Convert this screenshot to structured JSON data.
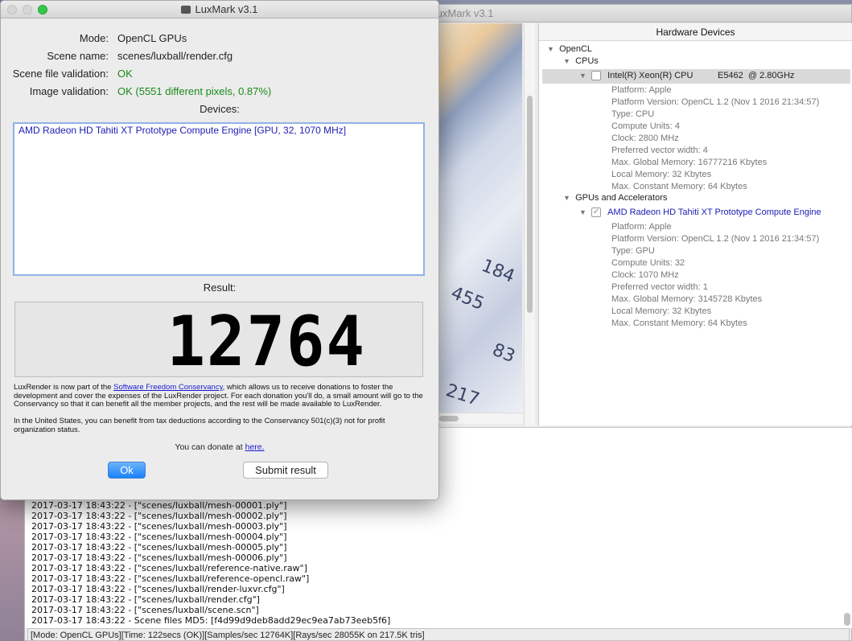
{
  "main_window": {
    "title": "LuxMark v3.1",
    "scene_numbers": [
      "184",
      "455",
      "83",
      "217"
    ]
  },
  "hardware": {
    "header": "Hardware Devices",
    "root": "OpenCL",
    "cpus_label": "CPUs",
    "cpu_device": {
      "name": "Intel(R) Xeon(R) CPU          E5462  @ 2.80GHz",
      "props": [
        "Platform: Apple",
        "Platform Version: OpenCL 1.2 (Nov  1 2016 21:34:57)",
        "Type: CPU",
        "Compute Units: 4",
        "Clock: 2800 MHz",
        "Preferred vector width: 4",
        "Max. Global Memory: 16777216 Kbytes",
        "Local Memory: 32 Kbytes",
        "Max. Constant Memory: 64 Kbytes"
      ]
    },
    "gpus_label": "GPUs and Accelerators",
    "gpu_device": {
      "name": "AMD Radeon HD Tahiti XT Prototype Compute Engine",
      "props": [
        "Platform: Apple",
        "Platform Version: OpenCL 1.2 (Nov  1 2016 21:34:57)",
        "Type: GPU",
        "Compute Units: 32",
        "Clock: 1070 MHz",
        "Preferred vector width: 1",
        "Max. Global Memory: 3145728 Kbytes",
        "Local Memory: 32 Kbytes",
        "Max. Constant Memory: 64 Kbytes"
      ]
    }
  },
  "log": [
    "2017-03-17 18:43:22 -   [\"scenes/luxball/mesh-00001.ply\"]",
    "2017-03-17 18:43:22 -   [\"scenes/luxball/mesh-00002.ply\"]",
    "2017-03-17 18:43:22 -   [\"scenes/luxball/mesh-00003.ply\"]",
    "2017-03-17 18:43:22 -   [\"scenes/luxball/mesh-00004.ply\"]",
    "2017-03-17 18:43:22 -   [\"scenes/luxball/mesh-00005.ply\"]",
    "2017-03-17 18:43:22 -   [\"scenes/luxball/mesh-00006.ply\"]",
    "2017-03-17 18:43:22 -   [\"scenes/luxball/reference-native.raw\"]",
    "2017-03-17 18:43:22 -   [\"scenes/luxball/reference-opencl.raw\"]",
    "2017-03-17 18:43:22 -   [\"scenes/luxball/render-luxvr.cfg\"]",
    "2017-03-17 18:43:22 -   [\"scenes/luxball/render.cfg\"]",
    "2017-03-17 18:43:22 -   [\"scenes/luxball/scene.scn\"]",
    "2017-03-17 18:43:22 - Scene files MD5: [f4d99d9deb8add29ec9ea7ab73eeb5f6]"
  ],
  "status_bar": "[Mode: OpenCL GPUs][Time: 122secs (OK)][Samples/sec  12764K][Rays/sec  28055K on 217.5K tris]",
  "dialog": {
    "title": "LuxMark v3.1",
    "mode_label": "Mode:",
    "mode_value": "OpenCL GPUs",
    "scene_label": "Scene name:",
    "scene_value": "scenes/luxball/render.cfg",
    "scene_validation_label": "Scene file validation:",
    "scene_validation_value": "OK",
    "image_validation_label": "Image validation:",
    "image_validation_value": "OK (5551 different pixels, 0.87%)",
    "devices_label": "Devices:",
    "devices": [
      "AMD Radeon HD Tahiti XT Prototype Compute Engine [GPU, 32, 1070 MHz]"
    ],
    "result_label": "Result:",
    "result_value": "12764",
    "para1_before": "LuxRender is now part of the ",
    "para1_link": "Software Freedom Conservancy",
    "para1_after": ", which allows us to receive donations to foster the development and cover the expenses of the LuxRender project. For each donation you'll do, a small amount will go to the Conservancy so that it can benefit all the member projects, and the rest will be made available to LuxRender.",
    "para2": "In the United States, you can benefit from tax deductions according to the Conservancy 501(c)(3) not for profit organization status.",
    "donate_text": "You can donate at ",
    "donate_link": "here.",
    "ok_button": "Ok",
    "submit_button": "Submit result"
  }
}
